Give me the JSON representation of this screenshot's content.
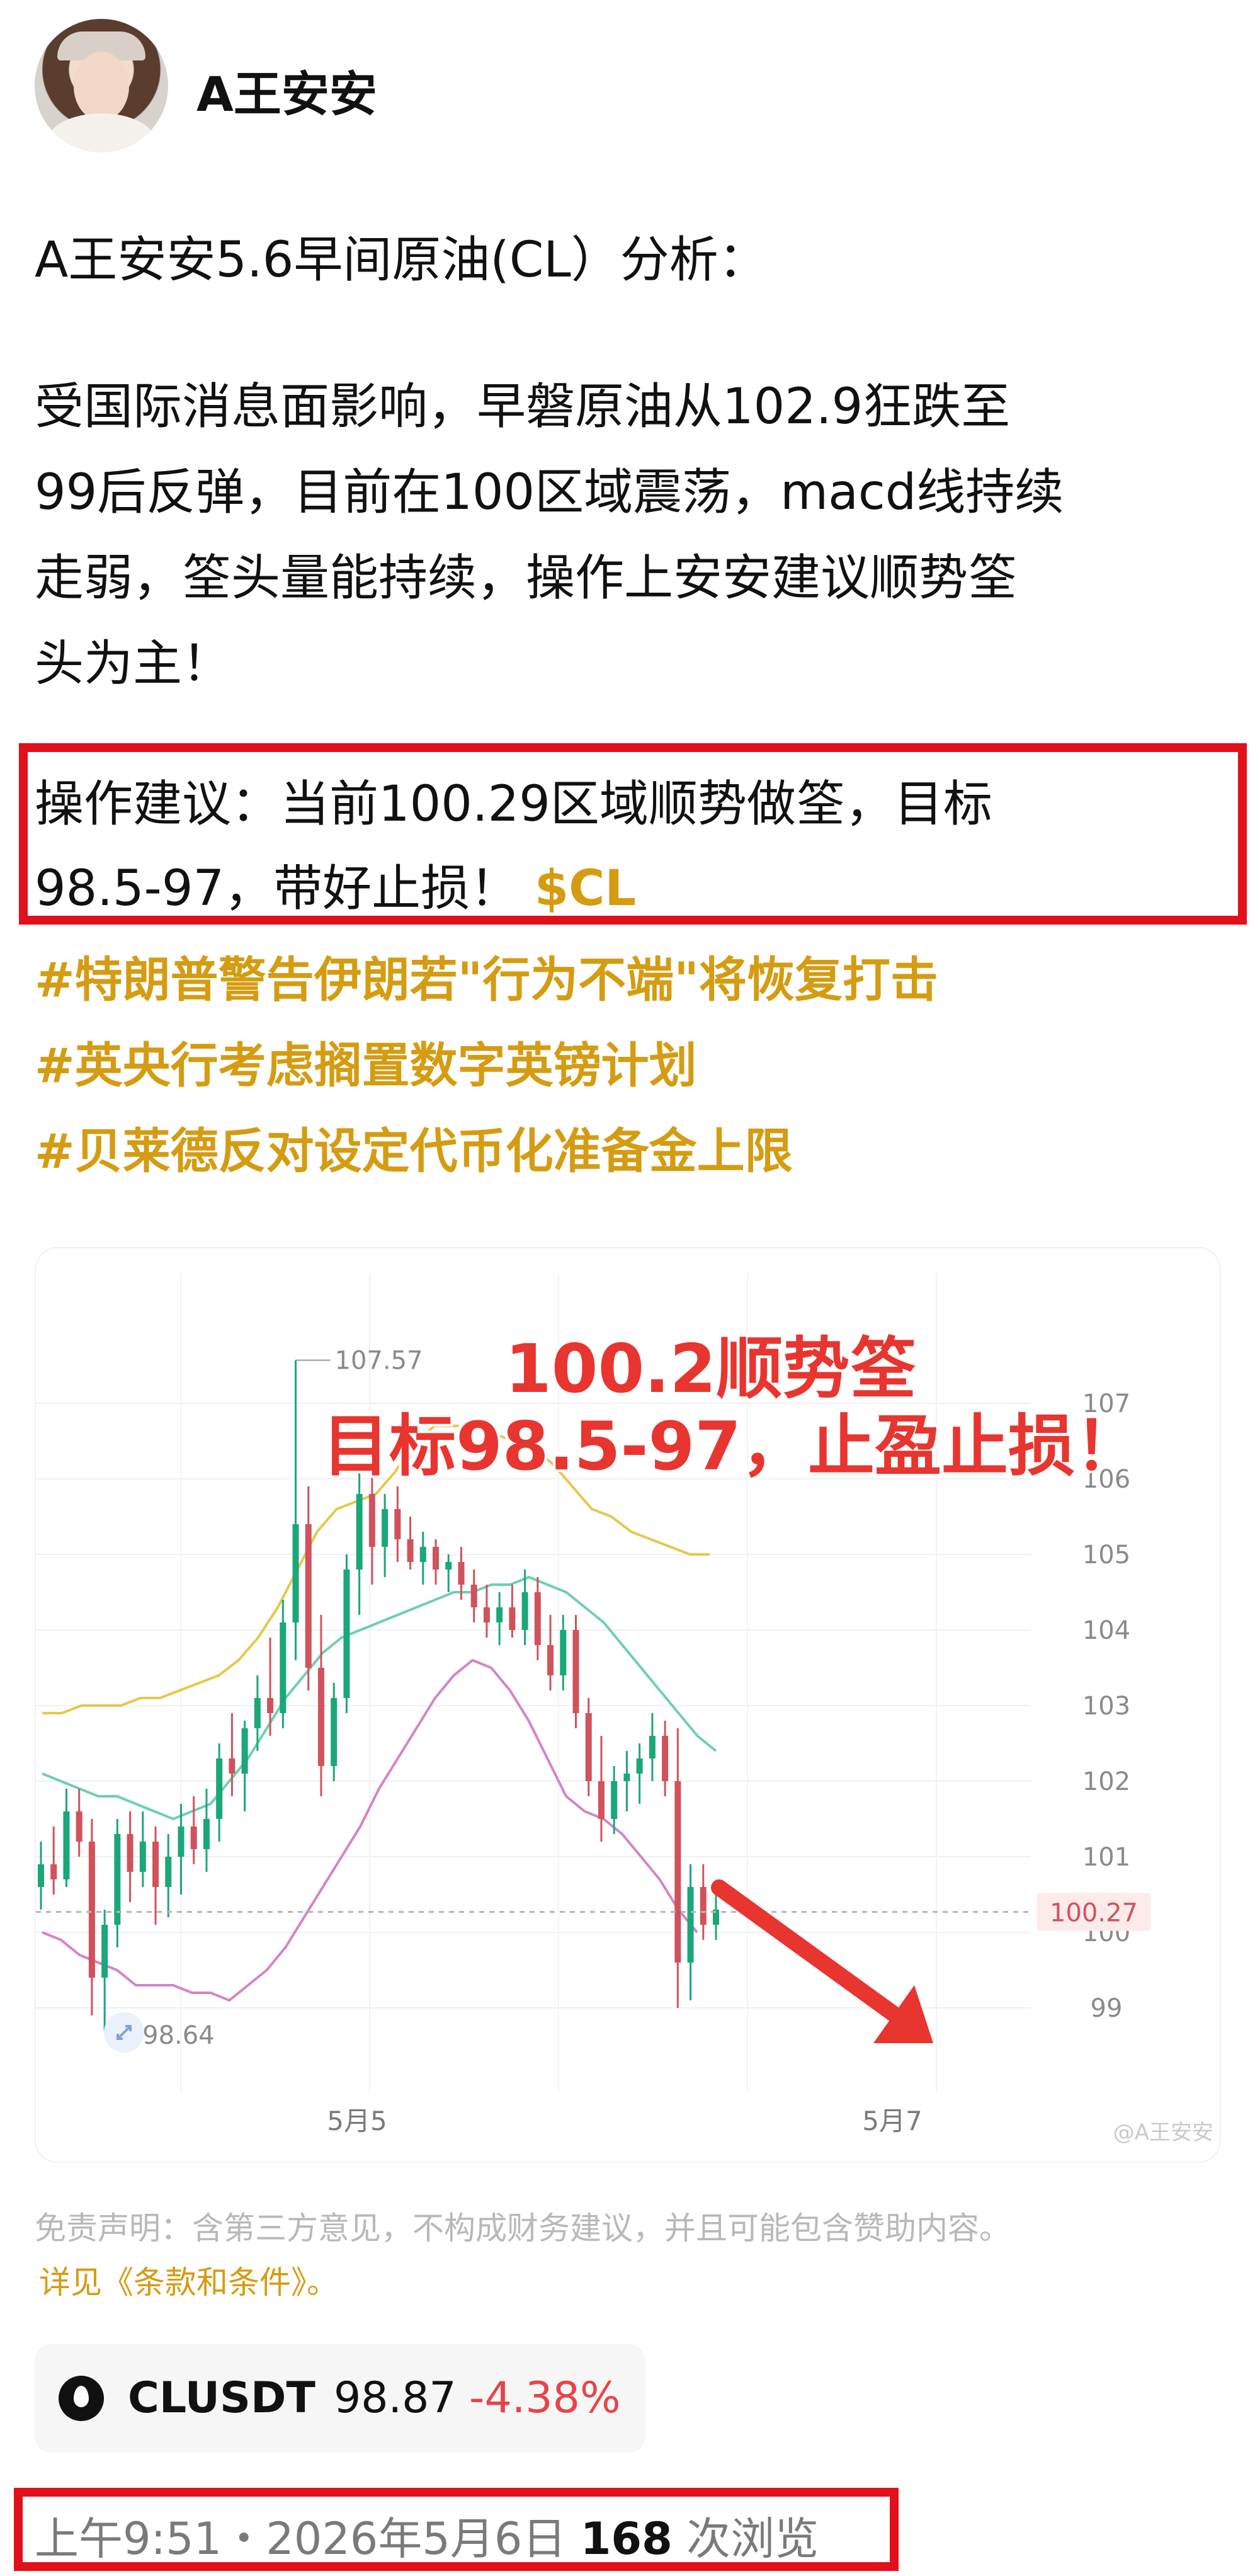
{
  "header": {
    "username": "A王安安"
  },
  "post": {
    "title": "A王安安5.6早间原油(CL）分析：",
    "paragraph_lines": [
      "受国际消息面影响，早磐原油从102.9狂跌至",
      "99后反弹，目前在100区域震荡，macd线持续",
      "走弱，筌头量能持续，操作上安安建议顺势筌",
      "头为主！"
    ],
    "advice_line1": "操作建议：当前100.29区域顺势做筌，目标",
    "advice_line2": "98.5-97，带好止损！",
    "cashtag": "$CL",
    "hashtags": [
      "#特朗普警告伊朗若\"行为不端\"将恢复打击",
      "#英央行考虑搁置数字英镑计划",
      "#贝莱德反对设定代币化准备金上限"
    ]
  },
  "chart": {
    "annotation_line1": "100.2顺势筌",
    "annotation_line2": "目标98.5-97，止盈止损！",
    "watermark": "@A王安安",
    "current_price_label": "100.27",
    "high_label": "107.57",
    "low_label": "98.64"
  },
  "chart_data": {
    "type": "candlestick",
    "y_axis_ticks": [
      "107",
      "106",
      "105",
      "104",
      "103",
      "102",
      "101",
      "100",
      "99"
    ],
    "ylim": [
      98.3,
      107.8
    ],
    "x_axis_ticks": [
      "5月5",
      "5月7"
    ],
    "current_price": 100.27,
    "high": 107.57,
    "low": 98.64,
    "candles": [
      [
        100.6,
        101.2,
        100.3,
        100.9
      ],
      [
        100.9,
        101.4,
        100.5,
        100.7
      ],
      [
        100.7,
        101.9,
        100.6,
        101.6
      ],
      [
        101.6,
        101.9,
        101.0,
        101.2
      ],
      [
        101.2,
        101.5,
        98.9,
        99.4
      ],
      [
        99.4,
        100.3,
        98.7,
        100.1
      ],
      [
        100.1,
        101.5,
        99.8,
        101.3
      ],
      [
        101.3,
        101.6,
        100.4,
        100.8
      ],
      [
        100.8,
        101.6,
        100.6,
        101.2
      ],
      [
        101.2,
        101.4,
        100.1,
        100.6
      ],
      [
        100.6,
        101.3,
        100.2,
        101.0
      ],
      [
        101.0,
        101.7,
        100.5,
        101.4
      ],
      [
        101.4,
        101.8,
        100.9,
        101.1
      ],
      [
        101.1,
        101.9,
        100.8,
        101.5
      ],
      [
        101.5,
        102.5,
        101.2,
        102.3
      ],
      [
        102.3,
        102.9,
        101.8,
        102.1
      ],
      [
        102.1,
        102.8,
        101.6,
        102.7
      ],
      [
        102.7,
        103.4,
        102.4,
        103.1
      ],
      [
        103.1,
        103.9,
        102.6,
        102.9
      ],
      [
        102.9,
        104.4,
        102.7,
        104.1
      ],
      [
        104.1,
        107.57,
        103.6,
        105.4
      ],
      [
        105.4,
        105.9,
        103.2,
        103.5
      ],
      [
        103.5,
        104.2,
        101.8,
        102.2
      ],
      [
        102.2,
        103.3,
        102.0,
        103.1
      ],
      [
        103.1,
        105.0,
        102.9,
        104.8
      ],
      [
        104.8,
        106.2,
        104.2,
        105.8
      ],
      [
        105.8,
        106.1,
        104.6,
        105.1
      ],
      [
        105.1,
        105.8,
        104.7,
        105.6
      ],
      [
        105.6,
        105.9,
        104.9,
        105.2
      ],
      [
        105.2,
        105.5,
        104.8,
        104.9
      ],
      [
        104.9,
        105.3,
        104.6,
        105.1
      ],
      [
        105.1,
        105.2,
        104.6,
        104.8
      ],
      [
        104.8,
        105.0,
        104.5,
        104.9
      ],
      [
        104.9,
        105.1,
        104.4,
        104.6
      ],
      [
        104.6,
        104.8,
        104.1,
        104.3
      ],
      [
        104.3,
        104.6,
        103.9,
        104.1
      ],
      [
        104.1,
        104.5,
        103.8,
        104.3
      ],
      [
        104.3,
        104.6,
        103.9,
        104.0
      ],
      [
        104.0,
        104.8,
        103.8,
        104.5
      ],
      [
        104.5,
        104.7,
        103.6,
        103.8
      ],
      [
        103.8,
        104.2,
        103.2,
        103.4
      ],
      [
        103.4,
        104.2,
        103.2,
        104.0
      ],
      [
        104.0,
        104.2,
        102.7,
        102.9
      ],
      [
        102.9,
        103.1,
        101.8,
        102.0
      ],
      [
        102.0,
        102.6,
        101.2,
        101.5
      ],
      [
        101.5,
        102.2,
        101.3,
        102.0
      ],
      [
        102.0,
        102.4,
        101.6,
        102.1
      ],
      [
        102.1,
        102.5,
        101.7,
        102.3
      ],
      [
        102.3,
        102.9,
        102.0,
        102.6
      ],
      [
        102.6,
        102.8,
        101.8,
        102.0
      ],
      [
        102.0,
        102.7,
        99.0,
        99.6
      ],
      [
        99.6,
        100.9,
        99.1,
        100.6
      ],
      [
        100.6,
        100.9,
        99.9,
        100.1
      ],
      [
        100.1,
        100.5,
        99.9,
        100.3
      ]
    ],
    "series": [
      {
        "values": [
          102.9,
          102.9,
          103.0,
          103.0,
          103.0,
          103.1,
          103.1,
          103.2,
          103.3,
          103.4,
          103.6,
          103.9,
          104.3,
          104.8,
          105.3,
          105.6,
          105.7,
          105.8,
          106.1,
          106.5,
          106.7,
          106.7,
          106.7,
          106.6,
          106.5,
          106.4,
          106.2,
          105.9,
          105.6,
          105.5,
          105.3,
          105.2,
          105.1,
          105.0,
          105.0
        ]
      },
      {
        "values": [
          102.1,
          102.0,
          101.9,
          101.8,
          101.8,
          101.7,
          101.6,
          101.5,
          101.6,
          101.7,
          102.0,
          102.3,
          102.7,
          103.1,
          103.4,
          103.7,
          103.9,
          104.0,
          104.1,
          104.2,
          104.3,
          104.4,
          104.5,
          104.5,
          104.6,
          104.6,
          104.7,
          104.6,
          104.5,
          104.3,
          104.1,
          103.8,
          103.5,
          103.2,
          102.9,
          102.6,
          102.4
        ]
      },
      {
        "values": [
          100.0,
          99.9,
          99.7,
          99.6,
          99.5,
          99.3,
          99.3,
          99.3,
          99.2,
          99.2,
          99.1,
          99.3,
          99.5,
          99.8,
          100.2,
          100.6,
          101.0,
          101.4,
          101.9,
          102.3,
          102.7,
          103.1,
          103.4,
          103.6,
          103.5,
          103.2,
          102.8,
          102.3,
          101.8,
          101.6,
          101.5,
          101.3,
          101.0,
          100.7,
          100.3,
          100.0
        ]
      }
    ]
  },
  "ticker": {
    "symbol": "CLUSDT",
    "price": "98.87",
    "change": "-4.38%"
  },
  "disclaimer": {
    "text": "免责声明：含第三方意见，不构成财务建议，并且可能包含赞助内容。",
    "terms_link": "详见《条款和条件》。"
  },
  "footer": {
    "time": "上午9:51・2026年5月6日",
    "views_count": "168",
    "views_suffix": "次浏览"
  },
  "colors": {
    "up": "#1aa77a",
    "down": "#d0525c",
    "gold": "#d59c12",
    "annotation_red": "#e8352f",
    "highlight_box": "#e1101a"
  }
}
